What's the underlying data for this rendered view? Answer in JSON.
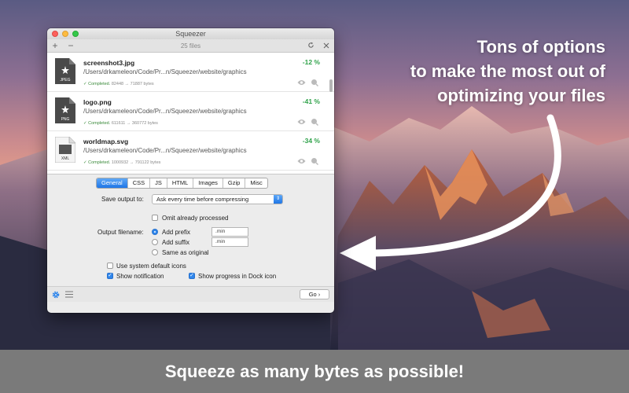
{
  "promo": {
    "line1": "Tons of options",
    "line2": "to make the most out of",
    "line3": "optimizing your files"
  },
  "footer": {
    "text": "Squeeze as many bytes as possible!"
  },
  "window": {
    "title": "Squeezer",
    "toolbar": {
      "add": "+",
      "remove": "−",
      "file_count": "25 files",
      "refresh_icon": "refresh-icon",
      "close_icon": "close-icon"
    },
    "files": [
      {
        "name": "screenshot3.jpg",
        "type": "JPEG",
        "path": "/Users/drkameleon/Code/Pr...n/Squeezer/website/graphics",
        "status": "Completed.",
        "bytes": "82448 → 71887 bytes",
        "percent": "-12 %"
      },
      {
        "name": "logo.png",
        "type": "PNG",
        "path": "/Users/drkameleon/Code/Pr...n/Squeezer/website/graphics",
        "status": "Completed.",
        "bytes": "611611 → 360772 bytes",
        "percent": "-41 %"
      },
      {
        "name": "worldmap.svg",
        "type": "XML",
        "path": "/Users/drkameleon/Code/Pr...n/Squeezer/website/graphics",
        "status": "Completed.",
        "bytes": "1000932 → 791122 bytes",
        "percent": "-34 %"
      }
    ],
    "tabs": [
      "General",
      "CSS",
      "JS",
      "HTML",
      "Images",
      "Gzip",
      "Misc"
    ],
    "active_tab": "General",
    "general": {
      "save_output_label": "Save output to:",
      "save_output_value": "Ask every time before compressing",
      "omit_processed": "Omit already processed",
      "output_filename_label": "Output filename:",
      "add_prefix": "Add prefix",
      "prefix_value": ".min",
      "add_suffix": "Add suffix",
      "suffix_value": ".min",
      "same_as_original": "Same as original",
      "use_system_icons": "Use system default icons",
      "show_notification": "Show notification",
      "show_progress_dock": "Show progress in Dock icon"
    },
    "go_button": "Go",
    "go_chevron": "›"
  }
}
